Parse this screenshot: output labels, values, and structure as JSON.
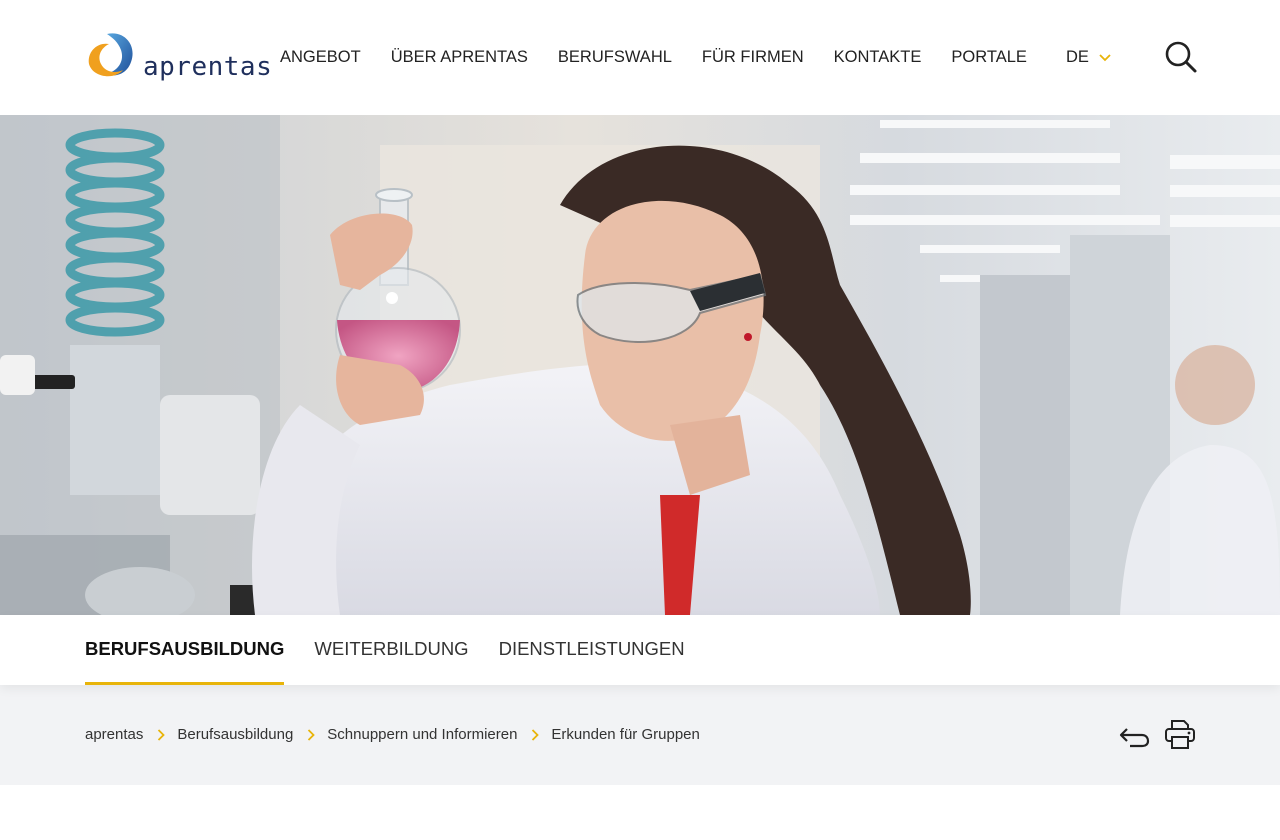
{
  "header": {
    "logo_text": "aprentas",
    "nav": [
      {
        "label": "ANGEBOT"
      },
      {
        "label": "ÜBER APRENTAS"
      },
      {
        "label": "BERUFSWAHL"
      },
      {
        "label": "FÜR FIRMEN"
      },
      {
        "label": "KONTAKTE"
      },
      {
        "label": "PORTALE"
      }
    ],
    "language": "DE",
    "search_icon": "search-icon"
  },
  "hero": {
    "icon": "lab-photo"
  },
  "section_tabs": [
    {
      "label": "BERUFSAUSBILDUNG",
      "active": true
    },
    {
      "label": "WEITERBILDUNG",
      "active": false
    },
    {
      "label": "DIENSTLEISTUNGEN",
      "active": false
    }
  ],
  "breadcrumb": [
    {
      "label": "aprentas"
    },
    {
      "label": "Berufsausbildung"
    },
    {
      "label": "Schnuppern und Informieren"
    },
    {
      "label": "Erkunden für Gruppen"
    }
  ],
  "actions": {
    "back_icon": "back-arrow-icon",
    "print_icon": "printer-icon"
  },
  "colors": {
    "accent": "#e8b40a",
    "brand_blue": "#1f2f5c",
    "brand_orange": "#f0a01e",
    "brand_sky": "#2f86c8",
    "crumb_bg": "#f2f3f5"
  }
}
